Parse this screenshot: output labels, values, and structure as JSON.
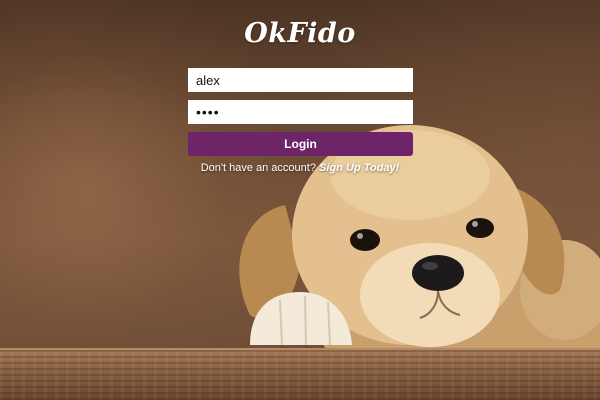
{
  "brand": {
    "logo_text": "OkFido"
  },
  "login_form": {
    "username_value": "alex",
    "password_value": "••••",
    "login_label": "Login"
  },
  "signup": {
    "prompt_text": "Don't have an account?",
    "link_text": "Sign Up Today!"
  },
  "colors": {
    "button": "#6e2468",
    "field_background": "#ffffff",
    "text": "#ffffff"
  }
}
